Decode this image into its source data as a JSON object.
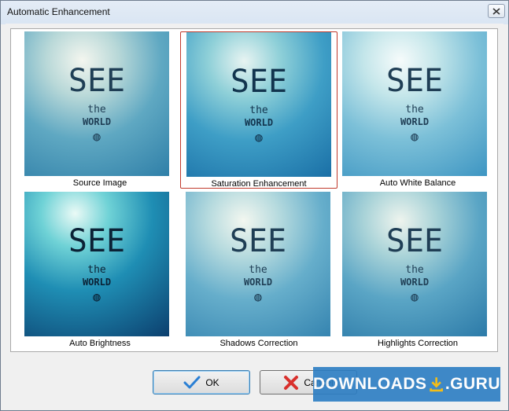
{
  "window": {
    "title": "Automatic Enhancement"
  },
  "thumbnails": [
    {
      "label": "Source Image"
    },
    {
      "label": "Saturation Enhancement"
    },
    {
      "label": "Auto White Balance"
    },
    {
      "label": "Auto Brightness"
    },
    {
      "label": "Shadows Correction"
    },
    {
      "label": "Highlights Correction"
    }
  ],
  "image_text": {
    "line1": "SEE",
    "line2": "the",
    "line3": "WORLD"
  },
  "buttons": {
    "ok_label": "OK",
    "cancel_label": "Cancel"
  },
  "watermark": {
    "left": "DOWNLOADS",
    "right": ".GURU"
  },
  "colors": {
    "selection_border": "#c0392b",
    "ok_icon": "#2a7fd4",
    "cancel_icon": "#d9302c"
  }
}
